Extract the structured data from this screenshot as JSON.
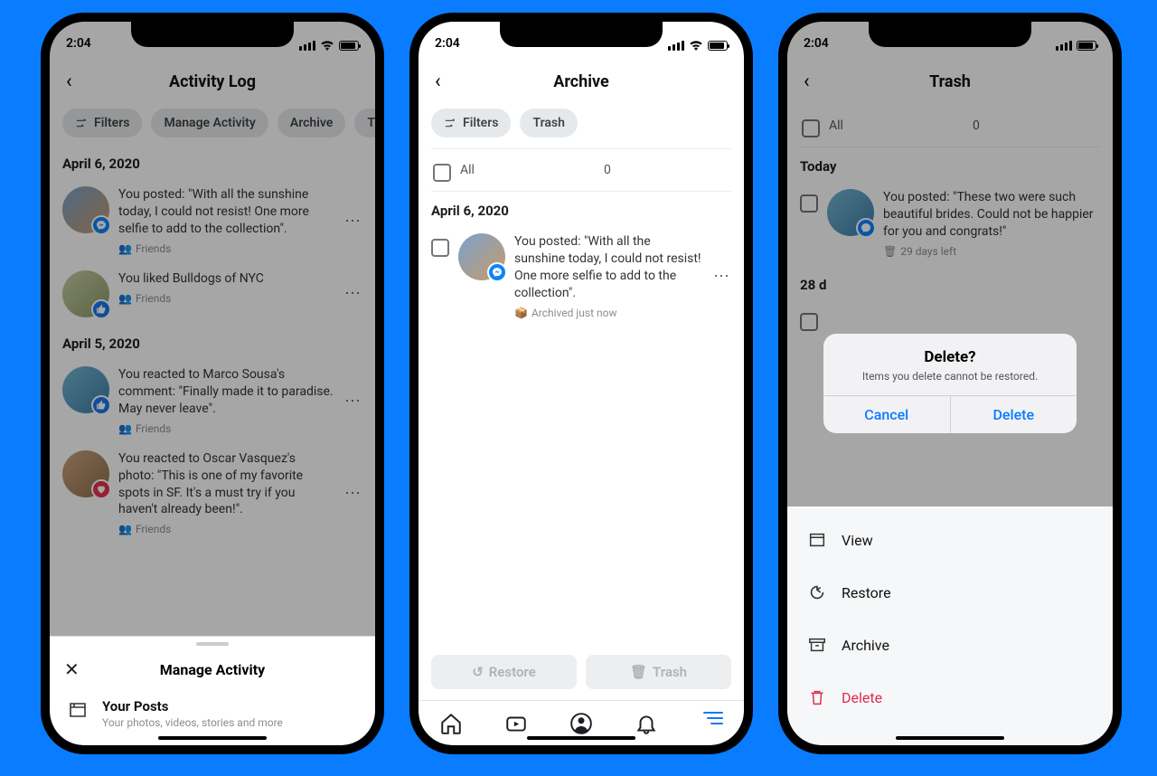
{
  "status": {
    "time": "2:04"
  },
  "phone1": {
    "title": "Activity Log",
    "chips": {
      "filters": "Filters",
      "manage": "Manage Activity",
      "archive": "Archive",
      "trash_initial": "T"
    },
    "sections": [
      {
        "date": "April 6, 2020",
        "items": [
          {
            "text": "You posted: \"With all the sunshine today, I could not resist! One more selfie to add to the collection\".",
            "meta": "Friends",
            "badge": "msg"
          },
          {
            "text": "You liked Bulldogs of NYC",
            "meta": "Friends",
            "badge": "like"
          }
        ]
      },
      {
        "date": "April 5, 2020",
        "items": [
          {
            "text": "You reacted to Marco Sousa's comment: \"Finally made it to paradise. May never leave\".",
            "meta": "Friends",
            "badge": "like"
          },
          {
            "text": "You reacted to Oscar Vasquez's photo: \"This is one of my favorite spots in SF. It's a must try if you haven't already been!\".",
            "meta": "Friends",
            "badge": "love"
          }
        ]
      }
    ],
    "sheet": {
      "title": "Manage Activity",
      "row_title": "Your Posts",
      "row_sub": "Your photos, videos, stories and more"
    }
  },
  "phone2": {
    "title": "Archive",
    "chips": {
      "filters": "Filters",
      "trash": "Trash"
    },
    "selectall": {
      "label": "All",
      "count": "0"
    },
    "section": {
      "date": "April 6, 2020",
      "item": {
        "text": "You posted: \"With all the sunshine today, I could not resist! One more selfie to add to the collection\".",
        "meta": "Archived just now",
        "badge": "msg"
      }
    },
    "buttons": {
      "restore": "Restore",
      "trash": "Trash"
    },
    "tabs": {
      "home": "home",
      "watch": "watch",
      "profile": "profile",
      "notif": "notif",
      "menu": "menu"
    }
  },
  "phone3": {
    "title": "Trash",
    "selectall": {
      "label": "All",
      "count": "0"
    },
    "sections": [
      {
        "date": "Today",
        "item": {
          "text": "You posted: \"These two were such beautiful brides. Could not be happier for you and congrats!\"",
          "meta": "29 days left",
          "badge": "msg"
        }
      },
      {
        "date": "28 d"
      }
    ],
    "alert": {
      "title": "Delete?",
      "message": "Items you delete cannot be restored.",
      "cancel": "Cancel",
      "confirm": "Delete"
    },
    "actions": {
      "view": "View",
      "restore": "Restore",
      "archive": "Archive",
      "delete": "Delete"
    }
  }
}
